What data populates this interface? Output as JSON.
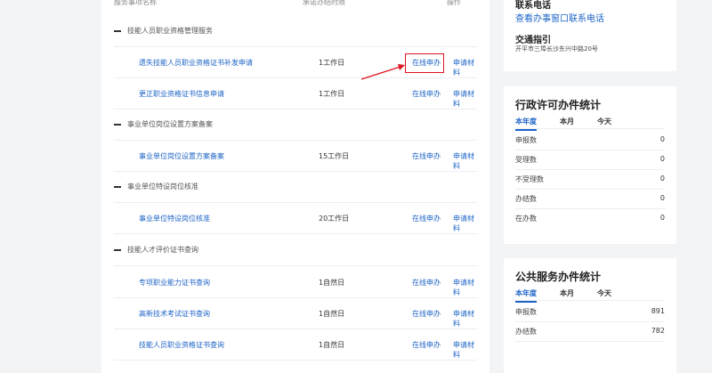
{
  "table": {
    "headers": {
      "name": "服务事项名称",
      "limit": "承诺办结时限",
      "action": "操作"
    },
    "groups": [
      {
        "title": "技能人员职业资格管理服务",
        "items": [
          {
            "name": "遗失技能人员职业资格证书补发申请",
            "limit": "1工作日",
            "apply": "在线申办",
            "materials": "申请材料"
          },
          {
            "name": "更正职业资格证书信息申请",
            "limit": "1工作日",
            "apply": "在线申办",
            "materials": "申请材料"
          }
        ]
      },
      {
        "title": "事业单位岗位设置方案备案",
        "items": [
          {
            "name": "事业单位岗位设置方案备案",
            "limit": "15工作日",
            "apply": "在线申办",
            "materials": "申请材料"
          }
        ]
      },
      {
        "title": "事业单位特设岗位核准",
        "items": [
          {
            "name": "事业单位特设岗位核准",
            "limit": "20工作日",
            "apply": "在线申办",
            "materials": "申请材料"
          }
        ]
      },
      {
        "title": "技能人才评价证书查询",
        "items": [
          {
            "name": "专项职业能力证书查询",
            "limit": "1自然日",
            "apply": "在线申办",
            "materials": "申请材料"
          },
          {
            "name": "高新技术考试证书查询",
            "limit": "1自然日",
            "apply": "在线申办",
            "materials": "申请材料"
          },
          {
            "name": "技能人员职业资格证书查询",
            "limit": "1自然日",
            "apply": "在线申办",
            "materials": "申请材料"
          }
        ]
      }
    ]
  },
  "contact": {
    "phone_label": "联系电话",
    "phone_link": "查看办事窗口联系电话",
    "traffic_label": "交通指引",
    "address": "开平市三埠长沙东兴中路20号"
  },
  "admin_stats": {
    "title": "行政许可办件统计",
    "tabs": [
      "本年度",
      "本月",
      "今天"
    ],
    "rows": [
      {
        "label": "申报数",
        "value": "0"
      },
      {
        "label": "受理数",
        "value": "0"
      },
      {
        "label": "不受理数",
        "value": "0"
      },
      {
        "label": "办结数",
        "value": "0"
      },
      {
        "label": "在办数",
        "value": "0"
      }
    ]
  },
  "public_stats": {
    "title": "公共服务办件统计",
    "tabs": [
      "本年度",
      "本月",
      "今天"
    ],
    "rows": [
      {
        "label": "申报数",
        "value": "891"
      },
      {
        "label": "办结数",
        "value": "782"
      }
    ]
  },
  "colors": {
    "link": "#1d64c7",
    "highlight": "#e0141e"
  }
}
